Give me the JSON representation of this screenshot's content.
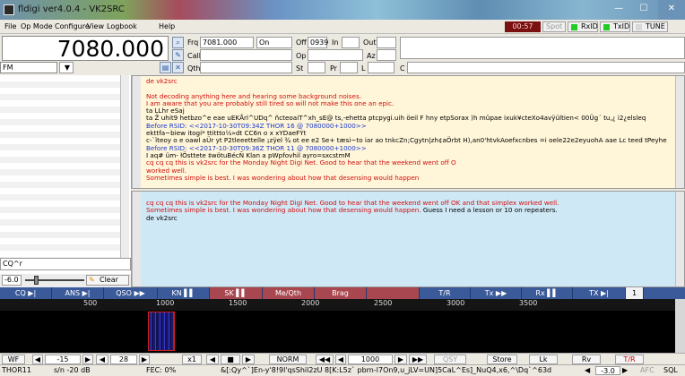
{
  "window": {
    "title": "fldigi ver4.0.4 - VK2SRC",
    "min": "—",
    "max": "☐",
    "close": "✕"
  },
  "menu": [
    "File",
    "Op Mode",
    "Configure",
    "View",
    "Logbook",
    "Help"
  ],
  "status_buttons": {
    "clock": "00:57",
    "spot": "Spot",
    "rxid": "RxID",
    "txid": "TxID",
    "tune": "TUNE"
  },
  "colors": {
    "led_green": "#22cc22",
    "led_off": "#d8d8d8",
    "clock_bg": "#7a1010"
  },
  "header": {
    "frequency": "7080.000",
    "frq_label": "Frq",
    "frq_value": "7081.000",
    "on_label": "On",
    "off_label": "Off",
    "off_value": "0939",
    "in_label": "In",
    "out_label": "Out",
    "call_label": "Call",
    "op_label": "Op",
    "az_label": "Az",
    "qth_label": "Qth",
    "st_label": "St",
    "pr_label": "Pr",
    "l_label": "L",
    "c_label": "C",
    "mode": "FM"
  },
  "left": {
    "cq_text": "CQ^r",
    "squelch": "-6.0",
    "clear": "Clear"
  },
  "rx_lines": [
    {
      "t": "de vk2src",
      "c": "red"
    },
    {
      "t": "",
      "c": ""
    },
    {
      "t": "Not decoding anything here and hearing some background noises.",
      "c": "red"
    },
    {
      "t": "I am aware that you are probably still tired so will not make this one an epic.",
      "c": "red"
    },
    {
      "t": "ta  LLhr  eSaj",
      "c": ""
    },
    {
      "t": "ta Ž  uhit9 hetbzo^e eae uEKÅrl^UDq^ ñcteoaiT^xh_sE@ ts,-ehetta ptcpygi.uih öeil F hny etpSorax   )h mûpae ixuk¥cteXo4avÿültien< 00Üg´ tu,¿  i2¿elsleq",
      "c": ""
    },
    {
      "t": "Before RSID: <<2017-10-30T09:34Z THOR 16 @ 7080000+1000>>",
      "c": "blue"
    },
    {
      "t": "ekttfa~biew itogi* ttittto½»dt CC6n o x xYDaeFÝt",
      "c": ""
    },
    {
      "t": "c-`ïteoy o  e oawl aÜr yt P2tleeettelle ¡zÿel ¾ ot ee e2 Se+ tæsi~to iar ao  tnkcZn;Cgytn|zh¢aÖrbt H),an0'htvkAoefxcnbes =i oele22e2eyuohA aae Lc teed tPeyhe",
      "c": ""
    },
    {
      "t": "Before RSID: <<2017-10-30T09:36Z THOR 11 @ 7080000+1000>>",
      "c": "blue"
    },
    {
      "t": "I  aq# üm- łÖsttete ‡wötuBécÑ Klan a pWpfovhil ayro=sxcstmM",
      "c": ""
    },
    {
      "t": "cq cq cq this is vk2src for the Monday Night Digi Net. Good to hear that the weekend went off O",
      "c": "red"
    },
    {
      "t": "worked well.",
      "c": "red"
    },
    {
      "t": "Sometimes simple is best. I was wondering about how that desensing would happen",
      "c": "red"
    }
  ],
  "tx_lines": [
    {
      "t": "cq cq cq this is vk2src for the Monday Night Digi Net. Good to hear that the weekend went off OK and that simplex worked well.",
      "c": "red"
    },
    {
      "t": "Sometimes simple is best. I was wondering about how that desensing would happen. Guess I need a lesson or 10 on repeaters.",
      "c": "mix"
    },
    {
      "t": "de vk2src",
      "c": ""
    }
  ],
  "tx_line2_red": "Sometimes simple is best. I was wondering about how that desensing would happen.",
  "tx_line2_rest": " Guess I need a lesson or 10 on repeaters.",
  "macros": [
    {
      "label": "CQ ▶|",
      "bg": "#3a5a9a"
    },
    {
      "label": "ANS ▶|",
      "bg": "#3a5a9a"
    },
    {
      "label": "QSO ▶▶",
      "bg": "#3a5a9a"
    },
    {
      "label": "KN ▌▌",
      "bg": "#3a5a9a"
    },
    {
      "label": "SK ▌▌",
      "bg": "#a8474f"
    },
    {
      "label": "Me/Qth",
      "bg": "#a8474f"
    },
    {
      "label": "Brag",
      "bg": "#a8474f"
    },
    {
      "label": "",
      "bg": "#a8474f"
    },
    {
      "label": "T/R",
      "bg": "#3a5a9a"
    },
    {
      "label": "Tx ▶▶",
      "bg": "#3a5a9a"
    },
    {
      "label": "Rx ▌▌",
      "bg": "#3a5a9a"
    },
    {
      "label": "TX ▶|",
      "bg": "#3a5a9a"
    },
    {
      "label": "1",
      "bg": "#f2f2f2"
    }
  ],
  "scale_ticks": [
    "500",
    "1000",
    "1500",
    "2000",
    "2500",
    "3000",
    "3500"
  ],
  "controls": {
    "wf": "WF",
    "ref": "-15",
    "range": "28",
    "x1": "x1",
    "norm": "NORM",
    "freq": "1000",
    "qsy": "QSY",
    "store": "Store",
    "lk": "Lk",
    "rv": "Rv",
    "tr": "T/R"
  },
  "status": {
    "mode": "THOR11",
    "sn": "s/n -20 dB",
    "fec": "FEC:  0%",
    "decode": "&[:Qy^`]En-y'8!9l'qsShil2zU 8[K:L5z` pbrn-l7On9,u_jLV=UN]5CaL^Es]_NuQ4,x6,^\\Dq`^63d",
    "imd": "-3.0",
    "afc": "AFC",
    "sql": "SQL"
  }
}
